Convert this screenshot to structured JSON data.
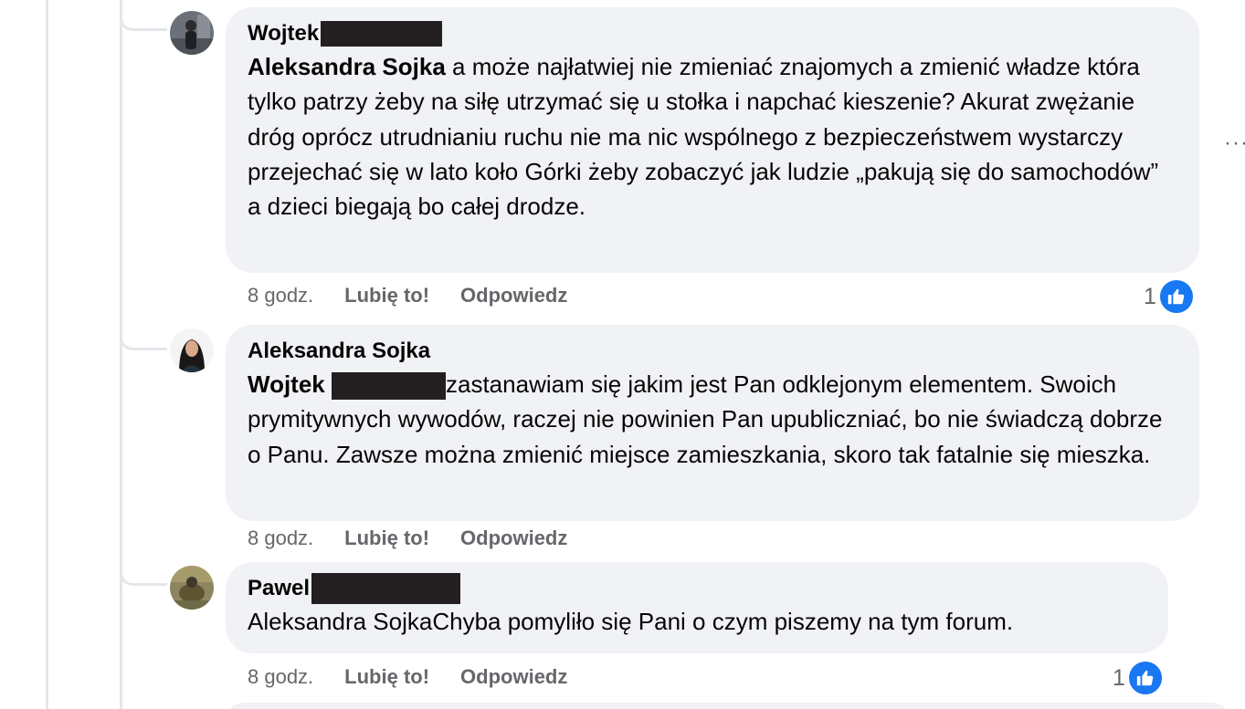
{
  "comments": [
    {
      "author": "Wojtek",
      "mention": "Aleksandra Sojka",
      "body": " a może najłatwiej nie zmieniać znajomych a zmienić władze która tylko patrzy żeby na siłę utrzymać się u stołka i napchać kieszenie? Akurat zwężanie dróg oprócz utrudnianiu ruchu nie ma nic wspólnego z bezpieczeństwem wystarczy przejechać się w lato koło Górki żeby zobaczyć jak ludzie „pakują się do samochodów” a dzieci biegają bo całej drodze.",
      "time": "8 godz.",
      "like_label": "Lubię to!",
      "reply_label": "Odpowiedz",
      "reaction_count": "1"
    },
    {
      "author": "Aleksandra Sojka",
      "mention": "Wojtek",
      "body": "zastanawiam się jakim jest Pan odklejonym elementem. Swoich prymitywnych wywodów, raczej nie powinien Pan upubliczniać, bo nie świadczą dobrze o Panu. Zawsze można zmienić miejsce zamieszkania, skoro tak fatalnie się mieszka.",
      "time": "8 godz.",
      "like_label": "Lubię to!",
      "reply_label": "Odpowiedz"
    },
    {
      "author": "Pawel",
      "body": "Aleksandra SojkaChyba pomyliło się Pani o czym piszemy na tym forum.",
      "time": "8 godz.",
      "like_label": "Lubię to!",
      "reply_label": "Odpowiedz",
      "reaction_count": "1"
    }
  ],
  "icons": {
    "more": "more-options-icon",
    "like": "thumbs-up-icon"
  },
  "colors": {
    "bubble": "#f0f2f5",
    "like_blue": "#1877f2",
    "meta_gray": "#65676b",
    "redaction": "#231f20"
  }
}
